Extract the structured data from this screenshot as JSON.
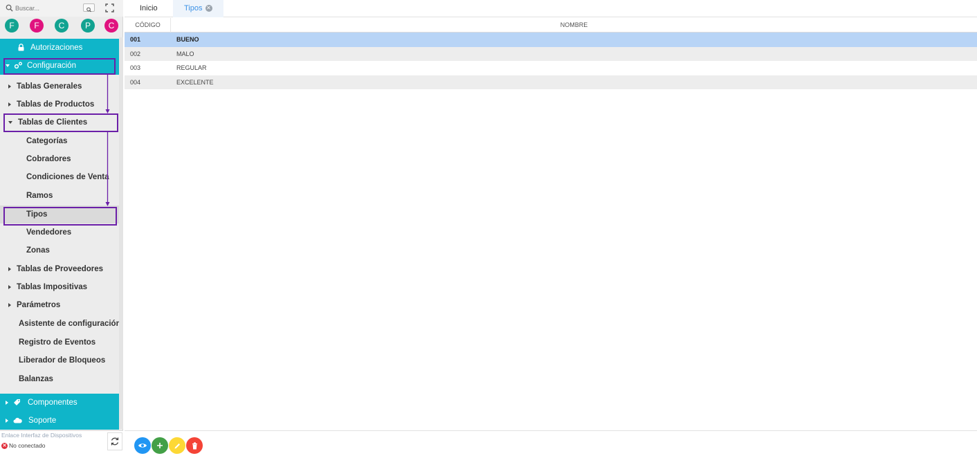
{
  "search": {
    "placeholder": "Buscar..."
  },
  "colors": {
    "accent": "#0fb5c9",
    "highlight": "#6b1fa8",
    "selected_row": "#b8d4f6",
    "teal": "#12a391",
    "magenta": "#e0137f"
  },
  "avatars": [
    {
      "letter": "F",
      "color": "#12a391"
    },
    {
      "letter": "F",
      "color": "#e0137f"
    },
    {
      "letter": "C",
      "color": "#12a391"
    },
    {
      "letter": "P",
      "color": "#12a391"
    },
    {
      "letter": "C",
      "color": "#e0137f"
    }
  ],
  "sidebar": {
    "autorizaciones": "Autorizaciones",
    "configuracion": "Configuración",
    "tablas_generales": "Tablas Generales",
    "tablas_productos": "Tablas de Productos",
    "tablas_clientes": "Tablas de Clientes",
    "categorias": "Categorías",
    "cobradores": "Cobradores",
    "condiciones_venta": "Condiciones de Venta",
    "ramos": "Ramos",
    "tipos": "Tipos",
    "vendedores": "Vendedores",
    "zonas": "Zonas",
    "tablas_proveedores": "Tablas de Proveedores",
    "tablas_impositivas": "Tablas Impositivas",
    "parametros": "Parámetros",
    "asistente": "Asistente de configuración",
    "registro_eventos": "Registro de Eventos",
    "liberador_bloqueos": "Liberador de Bloqueos",
    "balanzas": "Balanzas",
    "componentes": "Componentes",
    "soporte": "Soporte"
  },
  "status": {
    "link_label": "Enlace Interfaz de Dispositivos",
    "connection": "No conectado"
  },
  "tabs": {
    "inicio": "Inicio",
    "tipos": "Tipos"
  },
  "grid": {
    "headers": {
      "codigo": "CÓDIGO",
      "nombre": "NOMBRE"
    },
    "rows": [
      {
        "codigo": "001",
        "nombre": "BUENO"
      },
      {
        "codigo": "002",
        "nombre": "MALO"
      },
      {
        "codigo": "003",
        "nombre": "REGULAR"
      },
      {
        "codigo": "004",
        "nombre": "EXCELENTE"
      }
    ]
  },
  "toolbar": {
    "view_icon": "eye-icon",
    "add_icon": "plus-icon",
    "edit_icon": "pencil-icon",
    "delete_icon": "trash-icon"
  }
}
